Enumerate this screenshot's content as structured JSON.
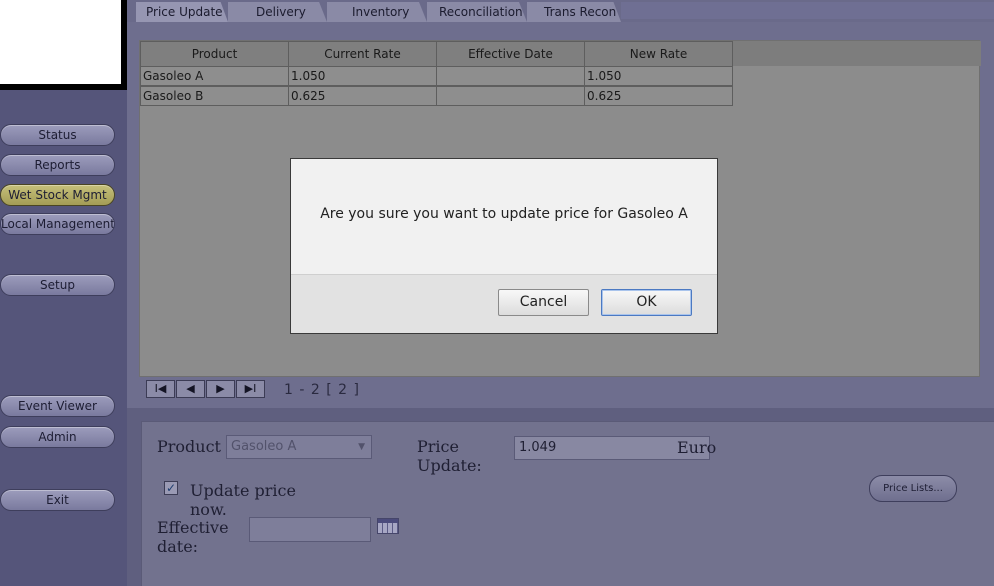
{
  "sidebar": {
    "items": [
      {
        "label": "Status"
      },
      {
        "label": "Reports"
      },
      {
        "label": "Wet Stock Mgmt"
      },
      {
        "label": "Local Management"
      },
      {
        "label": "Setup"
      },
      {
        "label": "Event Viewer"
      },
      {
        "label": "Admin"
      },
      {
        "label": "Exit"
      }
    ],
    "active_index": 2
  },
  "tabs": [
    {
      "label": "Price Update"
    },
    {
      "label": "Delivery"
    },
    {
      "label": "Inventory"
    },
    {
      "label": "Reconciliation"
    },
    {
      "label": "Trans Recon"
    }
  ],
  "table": {
    "columns": [
      "Product",
      "Current Rate",
      "Effective Date",
      "New Rate"
    ],
    "rows": [
      [
        "Gasoleo A",
        "1.050",
        "",
        "1.050"
      ],
      [
        "Gasoleo B",
        "0.625",
        "",
        "0.625"
      ]
    ]
  },
  "pager": {
    "first": "I◀",
    "prev": "◀",
    "next": "▶",
    "last": "▶I",
    "range_text": "1 - 2  [ 2 ]"
  },
  "form": {
    "product_label": "Product",
    "product_value": "Gasoleo A",
    "price_update_label_1": "Price",
    "price_update_label_2": "Update:",
    "price_value": "1.049",
    "currency": "Euro",
    "update_now_label_1": "Update price",
    "update_now_label_2": "now.",
    "update_now_checked": true,
    "effective_date_label_1": "Effective",
    "effective_date_label_2": "date:",
    "effective_date_value": "",
    "price_lists_button": "Price Lists..."
  },
  "dialog": {
    "message": "Are you sure you want to update price for Gasoleo A",
    "cancel_label": "Cancel",
    "ok_label": "OK"
  },
  "colors": {
    "sidebar_bg": "#55557a",
    "active_nav": "#c6c07a",
    "dialog_bg": "#f1f1f1"
  }
}
